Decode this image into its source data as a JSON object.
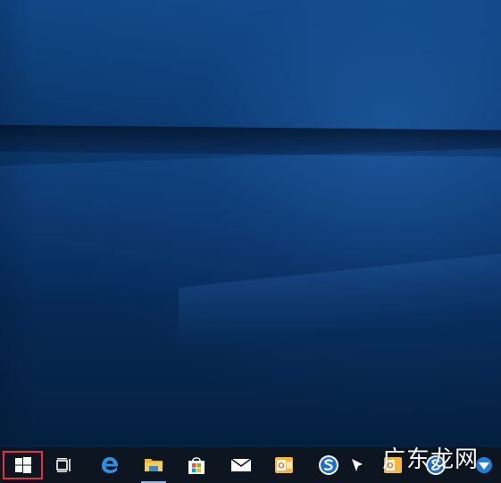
{
  "desktop": {
    "wallpaper": "windows-10-hero-blue",
    "colors": {
      "base": "#0a3566",
      "light": "#2d6fb6",
      "dark": "#04203f"
    }
  },
  "taskbar": {
    "background": "#0c1520",
    "items": [
      {
        "name": "start",
        "icon": "windows-logo-icon",
        "highlighted": true
      },
      {
        "name": "task-view",
        "icon": "task-view-icon"
      },
      {
        "name": "edge",
        "icon": "edge-icon"
      },
      {
        "name": "file-explorer",
        "icon": "folder-icon"
      },
      {
        "name": "store",
        "icon": "store-bag-icon"
      },
      {
        "name": "mail",
        "icon": "mail-icon"
      },
      {
        "name": "outlook",
        "icon": "outlook-icon"
      },
      {
        "name": "sogou-browser",
        "icon": "sogou-s-icon"
      },
      {
        "name": "pinned-app",
        "icon": "pin-icon"
      },
      {
        "name": "outlook-2",
        "icon": "outlook-icon"
      },
      {
        "name": "sogou-browser-2",
        "icon": "sogou-s-icon"
      },
      {
        "name": "network",
        "icon": "network-icon"
      }
    ],
    "highlight_color": "#e0353a"
  },
  "watermark": {
    "text": "广东龙网"
  }
}
